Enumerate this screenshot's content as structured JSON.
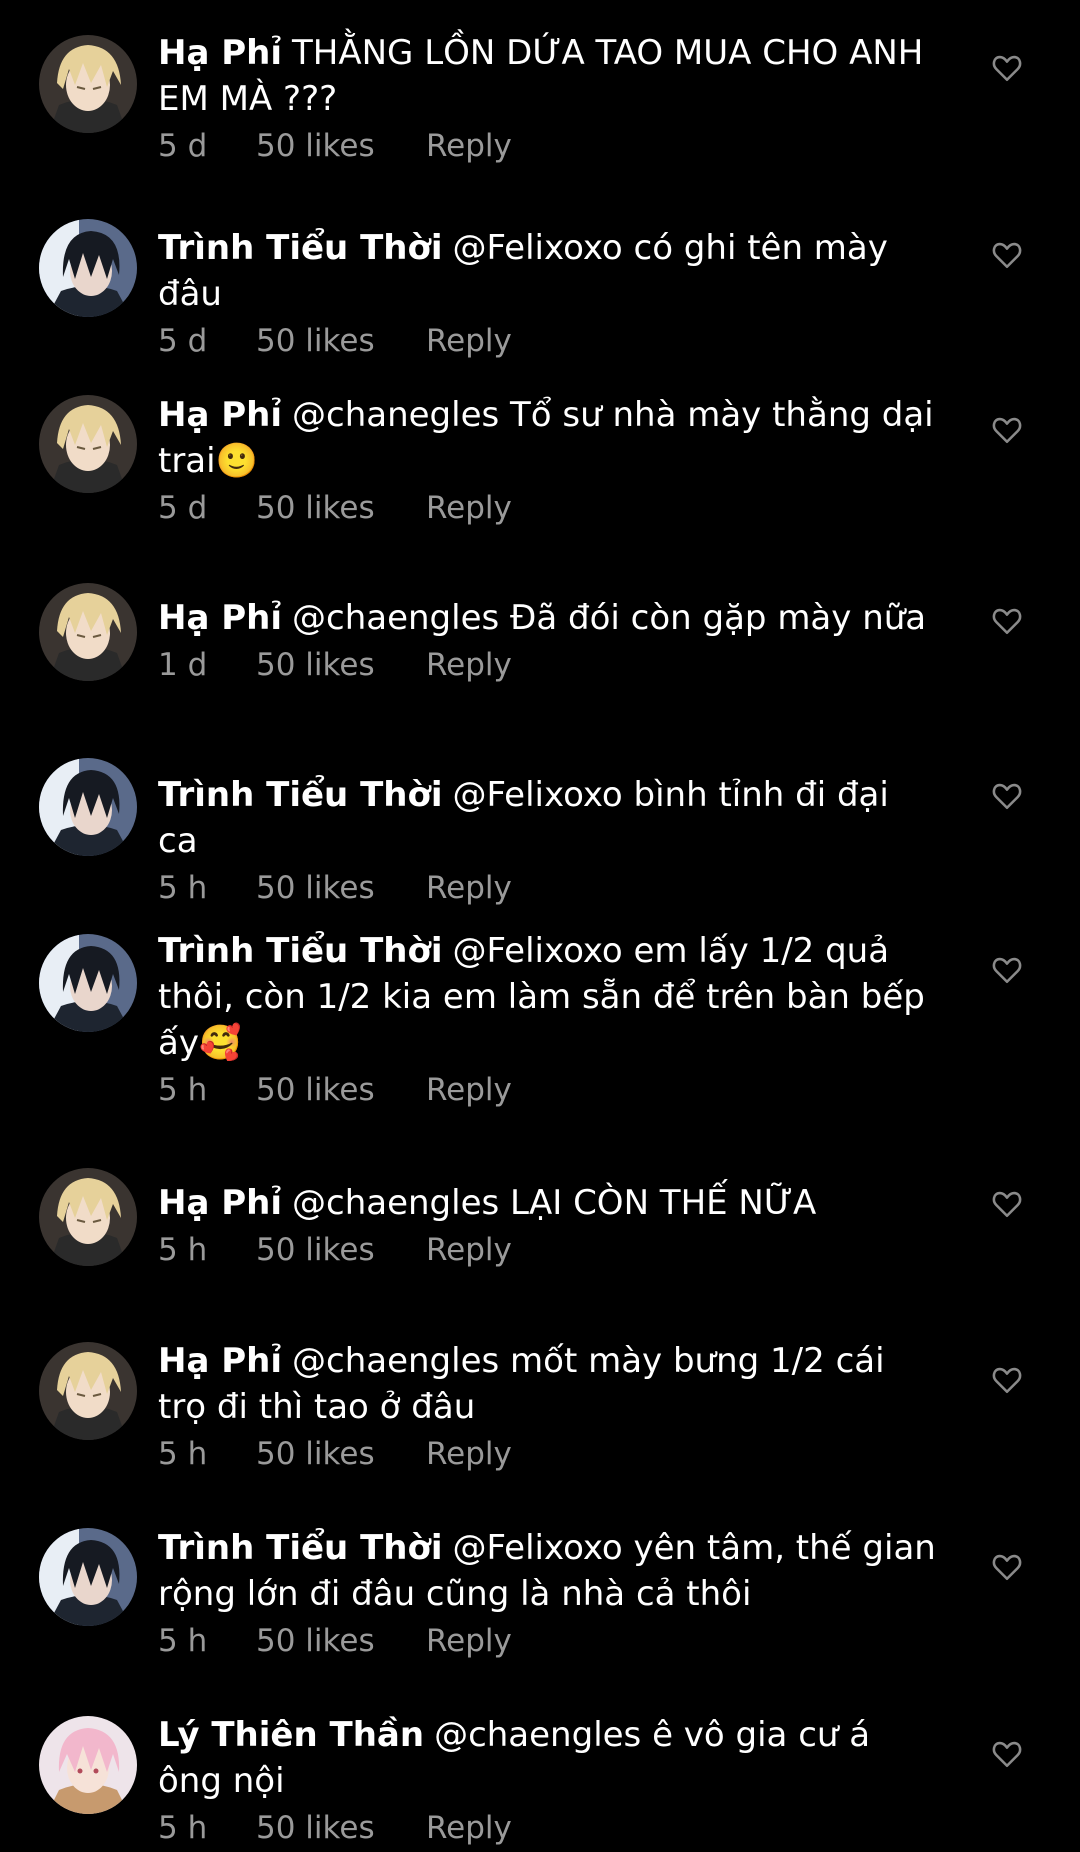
{
  "comments": [
    {
      "avatar": "blonde-anime-avatar",
      "username": "Hạ Phỉ",
      "text": "THẰNG LỒN DỨA TAO MUA CHO ANH EM MÀ ???",
      "time": "5 d",
      "likes": "50 likes",
      "reply": "Reply"
    },
    {
      "avatar": "dark-hair-anime-avatar",
      "username": "Trình Tiểu Thời",
      "text": "@Felixoxo có ghi tên mày đâu",
      "time": "5 d",
      "likes": "50 likes",
      "reply": "Reply"
    },
    {
      "avatar": "blonde-anime-avatar",
      "username": "Hạ Phỉ",
      "text": "@chanegles Tổ sư nhà mày thằng dại trai🙂",
      "time": "5 d",
      "likes": "50 likes",
      "reply": "Reply"
    },
    {
      "avatar": "blonde-anime-avatar",
      "username": "Hạ Phỉ",
      "text": "@chaengles Đã đói còn gặp mày nữa",
      "time": "1 d",
      "likes": "50 likes",
      "reply": "Reply"
    },
    {
      "avatar": "dark-hair-anime-avatar",
      "username": "Trình Tiểu Thời",
      "text": "@Felixoxo bình tỉnh đi đại ca",
      "time": "5 h",
      "likes": "50 likes",
      "reply": "Reply"
    },
    {
      "avatar": "dark-hair-anime-avatar",
      "username": "Trình Tiểu Thời",
      "text": "@Felixoxo em lấy 1/2 quả thôi, còn 1/2 kia em làm sẵn để trên bàn bếp ấy🥰",
      "time": "5 h",
      "likes": "50 likes",
      "reply": "Reply"
    },
    {
      "avatar": "blonde-anime-avatar",
      "username": "Hạ Phỉ",
      "text": "@chaengles LẠI CÒN THẾ NỮA",
      "time": "5 h",
      "likes": "50 likes",
      "reply": "Reply"
    },
    {
      "avatar": "blonde-anime-avatar",
      "username": "Hạ Phỉ",
      "text": "@chaengles mốt mày bưng 1/2 cái trọ đi thì tao ở đâu",
      "time": "5 h",
      "likes": "50 likes",
      "reply": "Reply"
    },
    {
      "avatar": "dark-hair-anime-avatar",
      "username": "Trình Tiểu Thời",
      "text": "@Felixoxo yên tâm, thế gian rộng lớn đi đâu cũng là nhà cả thôi",
      "time": "5 h",
      "likes": "50 likes",
      "reply": "Reply"
    },
    {
      "avatar": "pink-hair-anime-avatar",
      "username": "Lý Thiên Thần",
      "text": "@chaengles ê vô gia cư á ông nội",
      "time": "5 h",
      "likes": "50 likes",
      "reply": "Reply"
    }
  ],
  "colors": {
    "background": "#000000",
    "text": "#ffffff",
    "meta": "#9a9a9a",
    "heart": "#8a8a8a"
  },
  "icons": {
    "like": "heart-outline-icon"
  }
}
